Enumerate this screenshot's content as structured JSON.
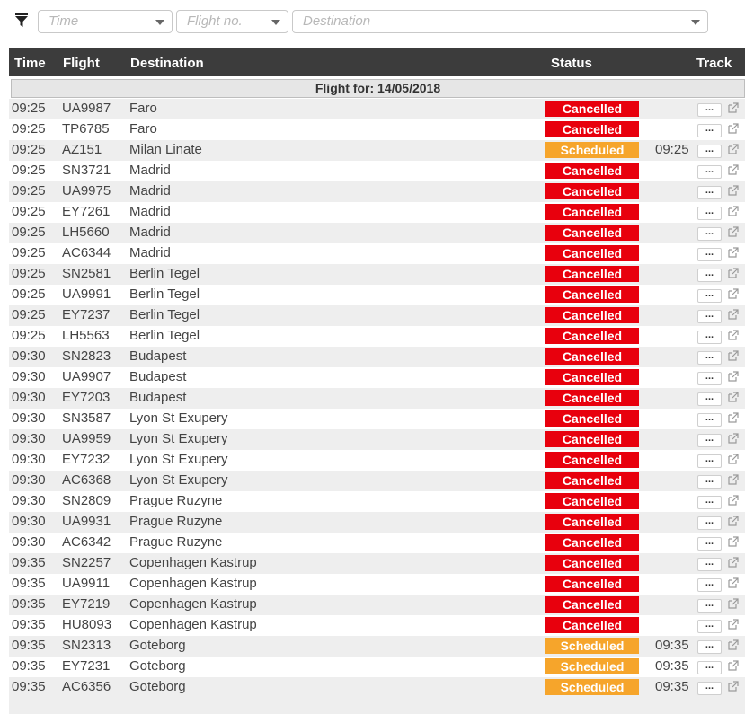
{
  "filters": {
    "time_placeholder": "Time",
    "flight_placeholder": "Flight no.",
    "destination_placeholder": "Destination"
  },
  "table": {
    "headers": {
      "time": "Time",
      "flight": "Flight",
      "destination": "Destination",
      "status": "Status",
      "track": "Track"
    },
    "date_label": "Flight for: 14/05/2018",
    "more_label": "...",
    "rows": [
      {
        "time": "09:25",
        "flight": "UA9987",
        "destination": "Faro",
        "status": "Cancelled",
        "actual": ""
      },
      {
        "time": "09:25",
        "flight": "TP6785",
        "destination": "Faro",
        "status": "Cancelled",
        "actual": ""
      },
      {
        "time": "09:25",
        "flight": "AZ151",
        "destination": "Milan Linate",
        "status": "Scheduled",
        "actual": "09:25"
      },
      {
        "time": "09:25",
        "flight": "SN3721",
        "destination": "Madrid",
        "status": "Cancelled",
        "actual": ""
      },
      {
        "time": "09:25",
        "flight": "UA9975",
        "destination": "Madrid",
        "status": "Cancelled",
        "actual": ""
      },
      {
        "time": "09:25",
        "flight": "EY7261",
        "destination": "Madrid",
        "status": "Cancelled",
        "actual": ""
      },
      {
        "time": "09:25",
        "flight": "LH5660",
        "destination": "Madrid",
        "status": "Cancelled",
        "actual": ""
      },
      {
        "time": "09:25",
        "flight": "AC6344",
        "destination": "Madrid",
        "status": "Cancelled",
        "actual": ""
      },
      {
        "time": "09:25",
        "flight": "SN2581",
        "destination": "Berlin Tegel",
        "status": "Cancelled",
        "actual": ""
      },
      {
        "time": "09:25",
        "flight": "UA9991",
        "destination": "Berlin Tegel",
        "status": "Cancelled",
        "actual": ""
      },
      {
        "time": "09:25",
        "flight": "EY7237",
        "destination": "Berlin Tegel",
        "status": "Cancelled",
        "actual": ""
      },
      {
        "time": "09:25",
        "flight": "LH5563",
        "destination": "Berlin Tegel",
        "status": "Cancelled",
        "actual": ""
      },
      {
        "time": "09:30",
        "flight": "SN2823",
        "destination": "Budapest",
        "status": "Cancelled",
        "actual": ""
      },
      {
        "time": "09:30",
        "flight": "UA9907",
        "destination": "Budapest",
        "status": "Cancelled",
        "actual": ""
      },
      {
        "time": "09:30",
        "flight": "EY7203",
        "destination": "Budapest",
        "status": "Cancelled",
        "actual": ""
      },
      {
        "time": "09:30",
        "flight": "SN3587",
        "destination": "Lyon St Exupery",
        "status": "Cancelled",
        "actual": ""
      },
      {
        "time": "09:30",
        "flight": "UA9959",
        "destination": "Lyon St Exupery",
        "status": "Cancelled",
        "actual": ""
      },
      {
        "time": "09:30",
        "flight": "EY7232",
        "destination": "Lyon St Exupery",
        "status": "Cancelled",
        "actual": ""
      },
      {
        "time": "09:30",
        "flight": "AC6368",
        "destination": "Lyon St Exupery",
        "status": "Cancelled",
        "actual": ""
      },
      {
        "time": "09:30",
        "flight": "SN2809",
        "destination": "Prague Ruzyne",
        "status": "Cancelled",
        "actual": ""
      },
      {
        "time": "09:30",
        "flight": "UA9931",
        "destination": "Prague Ruzyne",
        "status": "Cancelled",
        "actual": ""
      },
      {
        "time": "09:30",
        "flight": "AC6342",
        "destination": "Prague Ruzyne",
        "status": "Cancelled",
        "actual": ""
      },
      {
        "time": "09:35",
        "flight": "SN2257",
        "destination": "Copenhagen Kastrup",
        "status": "Cancelled",
        "actual": ""
      },
      {
        "time": "09:35",
        "flight": "UA9911",
        "destination": "Copenhagen Kastrup",
        "status": "Cancelled",
        "actual": ""
      },
      {
        "time": "09:35",
        "flight": "EY7219",
        "destination": "Copenhagen Kastrup",
        "status": "Cancelled",
        "actual": ""
      },
      {
        "time": "09:35",
        "flight": "HU8093",
        "destination": "Copenhagen Kastrup",
        "status": "Cancelled",
        "actual": ""
      },
      {
        "time": "09:35",
        "flight": "SN2313",
        "destination": "Goteborg",
        "status": "Scheduled",
        "actual": "09:35"
      },
      {
        "time": "09:35",
        "flight": "EY7231",
        "destination": "Goteborg",
        "status": "Scheduled",
        "actual": "09:35"
      },
      {
        "time": "09:35",
        "flight": "AC6356",
        "destination": "Goteborg",
        "status": "Scheduled",
        "actual": "09:35"
      }
    ]
  },
  "icons": {
    "filter": "filter-icon",
    "dropdown": "chevron-down-icon",
    "track": "external-link-icon"
  },
  "colors": {
    "cancelled": "#e8000d",
    "scheduled": "#f6a52b",
    "header_bg": "#3c3c3c"
  }
}
